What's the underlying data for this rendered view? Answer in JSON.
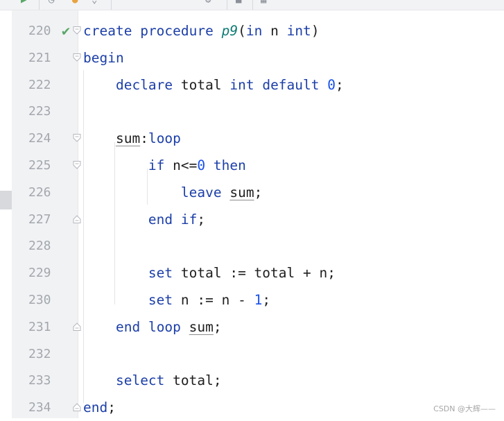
{
  "editor": {
    "lines": [
      {
        "number": "220",
        "tokens": [
          {
            "t": "create",
            "c": "kw"
          },
          {
            "t": " ",
            "c": "ident"
          },
          {
            "t": "procedure",
            "c": "kw"
          },
          {
            "t": " ",
            "c": "ident"
          },
          {
            "t": "p9",
            "c": "ital"
          },
          {
            "t": "(",
            "c": "ident"
          },
          {
            "t": "in",
            "c": "kw"
          },
          {
            "t": " n ",
            "c": "ident"
          },
          {
            "t": "int",
            "c": "kw"
          },
          {
            "t": ")",
            "c": "ident"
          }
        ]
      },
      {
        "number": "221",
        "tokens": [
          {
            "t": "begin",
            "c": "kw"
          }
        ]
      },
      {
        "number": "222",
        "tokens": [
          {
            "t": "    ",
            "c": "ident"
          },
          {
            "t": "declare",
            "c": "kw"
          },
          {
            "t": " total ",
            "c": "ident"
          },
          {
            "t": "int",
            "c": "kw"
          },
          {
            "t": " ",
            "c": "ident"
          },
          {
            "t": "default",
            "c": "kw"
          },
          {
            "t": " ",
            "c": "ident"
          },
          {
            "t": "0",
            "c": "num"
          },
          {
            "t": ";",
            "c": "ident"
          }
        ]
      },
      {
        "number": "223",
        "tokens": []
      },
      {
        "number": "224",
        "tokens": [
          {
            "t": "    ",
            "c": "ident"
          },
          {
            "t": "sum",
            "c": "ident label-ul"
          },
          {
            "t": ":",
            "c": "ident"
          },
          {
            "t": "loop",
            "c": "kw"
          }
        ]
      },
      {
        "number": "225",
        "tokens": [
          {
            "t": "        ",
            "c": "ident"
          },
          {
            "t": "if",
            "c": "kw"
          },
          {
            "t": " n<=",
            "c": "ident"
          },
          {
            "t": "0",
            "c": "num"
          },
          {
            "t": " ",
            "c": "ident"
          },
          {
            "t": "then",
            "c": "kw"
          }
        ]
      },
      {
        "number": "226",
        "tokens": [
          {
            "t": "            ",
            "c": "ident"
          },
          {
            "t": "leave",
            "c": "kw"
          },
          {
            "t": " ",
            "c": "ident"
          },
          {
            "t": "sum",
            "c": "ident label-ul"
          },
          {
            "t": ";",
            "c": "ident"
          }
        ]
      },
      {
        "number": "227",
        "tokens": [
          {
            "t": "        ",
            "c": "ident"
          },
          {
            "t": "end",
            "c": "kw"
          },
          {
            "t": " ",
            "c": "ident"
          },
          {
            "t": "if",
            "c": "kw"
          },
          {
            "t": ";",
            "c": "ident"
          }
        ]
      },
      {
        "number": "228",
        "tokens": []
      },
      {
        "number": "229",
        "tokens": [
          {
            "t": "        ",
            "c": "ident"
          },
          {
            "t": "set",
            "c": "kw"
          },
          {
            "t": " total := total + n;",
            "c": "ident"
          }
        ]
      },
      {
        "number": "230",
        "tokens": [
          {
            "t": "        ",
            "c": "ident"
          },
          {
            "t": "set",
            "c": "kw"
          },
          {
            "t": " n := n - ",
            "c": "ident"
          },
          {
            "t": "1",
            "c": "num"
          },
          {
            "t": ";",
            "c": "ident"
          }
        ]
      },
      {
        "number": "231",
        "tokens": [
          {
            "t": "    ",
            "c": "ident"
          },
          {
            "t": "end",
            "c": "kw"
          },
          {
            "t": " ",
            "c": "ident"
          },
          {
            "t": "loop",
            "c": "kw"
          },
          {
            "t": " ",
            "c": "ident"
          },
          {
            "t": "sum",
            "c": "ident label-ul"
          },
          {
            "t": ";",
            "c": "ident"
          }
        ]
      },
      {
        "number": "232",
        "tokens": []
      },
      {
        "number": "233",
        "tokens": [
          {
            "t": "    ",
            "c": "ident"
          },
          {
            "t": "select",
            "c": "kw"
          },
          {
            "t": " total;",
            "c": "ident"
          }
        ]
      },
      {
        "number": "234",
        "tokens": [
          {
            "t": "end",
            "c": "kw"
          },
          {
            "t": ";",
            "c": "ident"
          }
        ]
      }
    ],
    "check_icon": "checkmark-icon",
    "fold_icons": "fold-marker-icon"
  },
  "colors": {
    "keyword": "#1c3fa8",
    "procedure_name": "#0e7a72",
    "number": "#1750eb",
    "check": "#59a869"
  },
  "watermark": "CSDN @大辉——"
}
